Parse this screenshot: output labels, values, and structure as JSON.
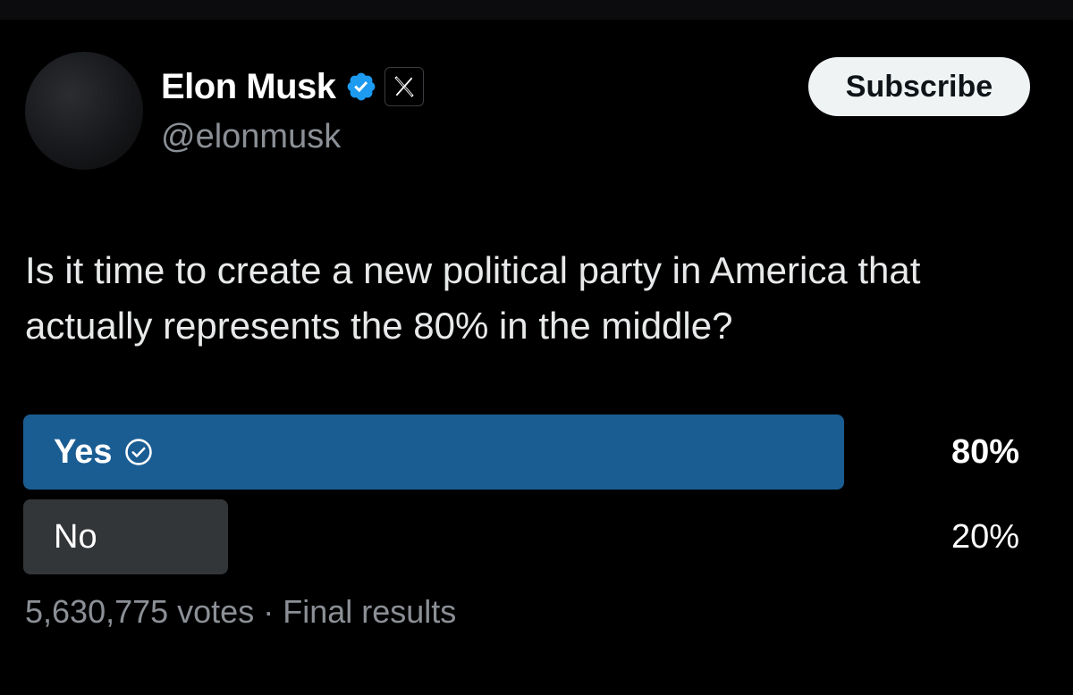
{
  "author": {
    "display_name": "Elon Musk",
    "handle": "@elonmusk",
    "verified_icon": "verified-badge-icon",
    "affiliate_icon": "x-logo-icon"
  },
  "actions": {
    "subscribe_label": "Subscribe"
  },
  "post": {
    "text": "Is it time to create a new political party in America that actually represents the 80% in the middle?"
  },
  "poll": {
    "options": [
      {
        "label": "Yes",
        "percent_label": "80%",
        "share": 80,
        "winner": true
      },
      {
        "label": "No",
        "percent_label": "20%",
        "share": 20,
        "winner": false
      }
    ],
    "votes": "5,630,775 votes",
    "separator": "·",
    "status": "Final results"
  },
  "colors": {
    "background": "#000000",
    "winner_bar": "#1a5d93",
    "other_bar": "#333639",
    "verified": "#1d9bf0",
    "muted_text": "#8b9096"
  }
}
